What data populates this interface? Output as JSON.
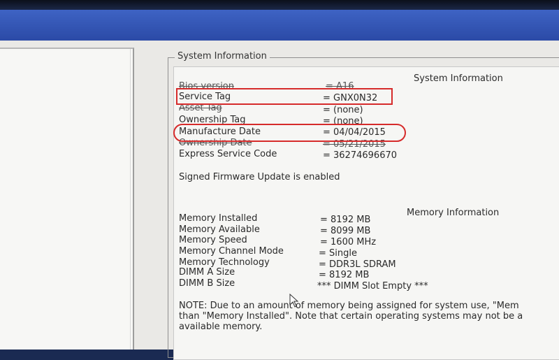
{
  "system_info_group_title": "System Information",
  "system_info_header": "System Information",
  "system_rows": [
    {
      "label": "Bios version",
      "value": "= A16"
    },
    {
      "label": "Service Tag",
      "value": "= GNX0N32"
    },
    {
      "label": "Asset Tag",
      "value": "= (none)"
    },
    {
      "label": "Ownership Tag",
      "value": "= (none)"
    },
    {
      "label": "Manufacture Date",
      "value": "= 04/04/2015"
    },
    {
      "label": "Ownership Date",
      "value": "= 05/21/2015"
    },
    {
      "label": "Express Service Code",
      "value": "= 36274696670"
    }
  ],
  "firmware_status": "Signed Firmware Update is enabled",
  "memory_info_header": "Memory Information",
  "memory_rows": [
    {
      "label": "Memory Installed",
      "value": "= 8192 MB"
    },
    {
      "label": "Memory Available",
      "value": "= 8099 MB"
    },
    {
      "label": "Memory Speed",
      "value": "= 1600 MHz"
    },
    {
      "label": "Memory Channel Mode",
      "value": "= Single"
    },
    {
      "label": "Memory Technology",
      "value": "= DDR3L SDRAM"
    },
    {
      "label": "DIMM A Size",
      "value": "= 8192 MB"
    },
    {
      "label": "DIMM B Size",
      "value": "*** DIMM Slot Empty ***"
    }
  ],
  "note_lines": [
    "NOTE: Due to an amount of memory being assigned for system use, \"Mem",
    "than \"Memory Installed\". Note that certain operating systems may not be a",
    "available memory."
  ],
  "highlight_color": "#d62b2b",
  "titlebar_color": "#2b4aa6"
}
